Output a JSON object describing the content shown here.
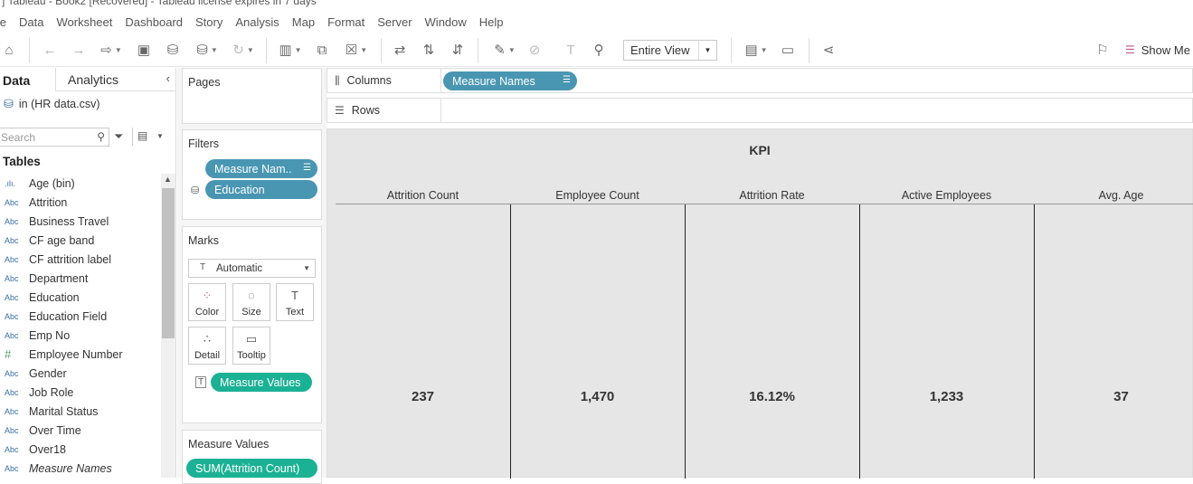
{
  "window": {
    "title": "] Tableau - Book2 [Recovered] - Tableau license expires in 7 days"
  },
  "menu": [
    "ile",
    "Data",
    "Worksheet",
    "Dashboard",
    "Story",
    "Analysis",
    "Map",
    "Format",
    "Server",
    "Window",
    "Help"
  ],
  "toolbar": {
    "fit_mode": "Entire View",
    "show_me": "Show Me"
  },
  "data_pane": {
    "tab_data": "Data",
    "tab_analytics": "Analytics",
    "datasource": "in (HR data.csv)",
    "search_placeholder": "Search",
    "tables_heading": "Tables",
    "fields": [
      {
        "type": ".ılı.",
        "name": "Age (bin)"
      },
      {
        "type": "Abc",
        "name": "Attrition"
      },
      {
        "type": "Abc",
        "name": "Business Travel"
      },
      {
        "type": "Abc",
        "name": "CF age band"
      },
      {
        "type": "Abc",
        "name": "CF attrition label"
      },
      {
        "type": "Abc",
        "name": "Department"
      },
      {
        "type": "Abc",
        "name": "Education"
      },
      {
        "type": "Abc",
        "name": "Education Field"
      },
      {
        "type": "Abc",
        "name": "Emp No"
      },
      {
        "type": "#",
        "name": "Employee Number"
      },
      {
        "type": "Abc",
        "name": "Gender"
      },
      {
        "type": "Abc",
        "name": "Job Role"
      },
      {
        "type": "Abc",
        "name": "Marital Status"
      },
      {
        "type": "Abc",
        "name": "Over Time"
      },
      {
        "type": "Abc",
        "name": "Over18"
      },
      {
        "type": "Abc",
        "name": "Measure Names"
      }
    ]
  },
  "pages": {
    "title": "Pages"
  },
  "filters": {
    "title": "Filters",
    "items": [
      "Measure Nam..",
      "Education"
    ]
  },
  "marks": {
    "title": "Marks",
    "type": "Automatic",
    "buttons": [
      "Color",
      "Size",
      "Text",
      "Detail",
      "Tooltip"
    ],
    "pill": "Measure Values"
  },
  "measure_values": {
    "title": "Measure Values",
    "pill": "SUM(Attrition Count)"
  },
  "columns": {
    "label": "Columns",
    "pill": "Measure Names"
  },
  "rows": {
    "label": "Rows"
  },
  "view": {
    "title": "KPI",
    "headers": [
      "Attrition Count",
      "Employee Count",
      "Attrition Rate",
      "Active Employees",
      "Avg. Age"
    ],
    "values": [
      "237",
      "1,470",
      "16.12%",
      "1,233",
      "37"
    ]
  },
  "colors": {
    "blue_pill": "#4996b2",
    "green_pill": "#1bb194",
    "view_bg": "#e6e6e6"
  }
}
